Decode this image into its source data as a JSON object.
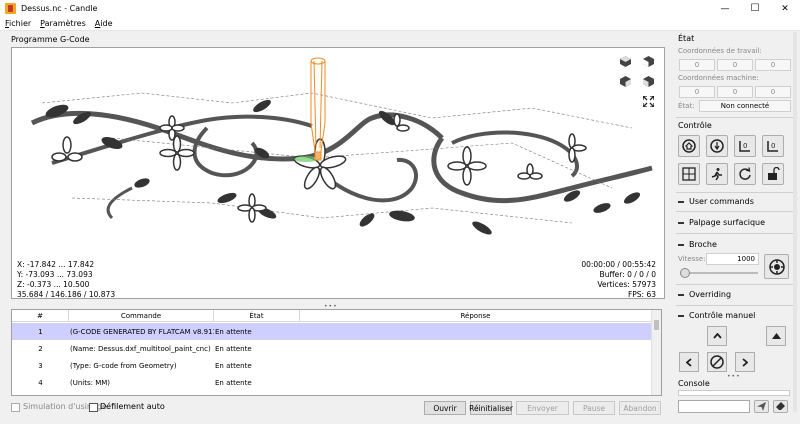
{
  "window": {
    "title": "Dessus.nc - Candle",
    "minimize": "—",
    "maximize": "☐",
    "close": "✕"
  },
  "menu": [
    {
      "label": "Fichier",
      "accel": "F"
    },
    {
      "label": "Paramètres",
      "accel": "P"
    },
    {
      "label": "Aide",
      "accel": "A"
    }
  ],
  "gcode_panel": {
    "title": "Programme G-Code"
  },
  "viewport": {
    "coords": [
      "X: -17.842 ... 17.842",
      "Y: -73.093 ... 73.093",
      "Z: -0.373 ... 10.500",
      "35.684 / 146.186 / 10.873"
    ],
    "stats": [
      "00:00:00 / 00:55:42",
      "Buffer: 0 / 0 / 0",
      "Vertices: 57973",
      "FPS: 63"
    ]
  },
  "table": {
    "headers": [
      "#",
      "Commande",
      "État",
      "Réponse"
    ],
    "rows": [
      {
        "num": "1",
        "command": "(G-CODE GENERATED BY FLATCAM v8.911 - w...",
        "state": "En attente",
        "response": ""
      },
      {
        "num": "2",
        "command": "(Name: Dessus.dxf_multitool_paint_cnc)",
        "state": "En attente",
        "response": ""
      },
      {
        "num": "3",
        "command": "(Type: G-code from Geometry)",
        "state": "En attente",
        "response": ""
      },
      {
        "num": "4",
        "command": "(Units: MM)",
        "state": "En attente",
        "response": ""
      }
    ]
  },
  "bottom": {
    "sim_label": "Simulation d'usinage",
    "scroll_label": "Défilement auto",
    "open": "Ouvrir",
    "reset": "Réinitialiser",
    "send": "Envoyer",
    "pause": "Pause",
    "abort": "Abandon"
  },
  "state_panel": {
    "title": "État",
    "work_coords_label": "Coordonnées de travail:",
    "work_coords": [
      "0",
      "0",
      "0"
    ],
    "machine_coords_label": "Coordonnées machine:",
    "machine_coords": [
      "0",
      "0",
      "0"
    ],
    "status_label": "État:",
    "status_value": "Non connecté"
  },
  "control_panel": {
    "title": "Contrôle"
  },
  "sections": {
    "user_commands": "User commands",
    "probing": "Palpage surfacique",
    "spindle": "Broche",
    "speed_label": "Vitesse:",
    "speed_value": "1000",
    "overriding": "Overriding",
    "manual_control": "Contrôle manuel",
    "console": "Console"
  }
}
